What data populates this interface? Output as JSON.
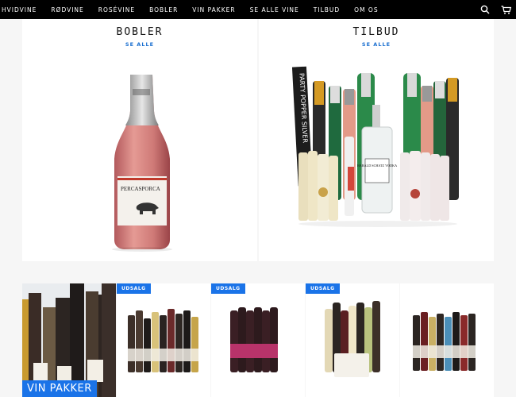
{
  "nav": {
    "items": [
      "HVIDVINE",
      "RØDVINE",
      "ROSÉVINE",
      "BOBLER",
      "VIN PAKKER",
      "SE ALLE VINE",
      "TILBUD",
      "OM OS"
    ]
  },
  "sections": [
    {
      "title": "BOBLER",
      "link": "SE ALLE"
    },
    {
      "title": "TILBUD",
      "link": "SE ALLE"
    }
  ],
  "products": {
    "bobler_bottle_label": "PERCASPORCA",
    "tilbud_banner": "PARTY POPPER SILVER",
    "tilbud_vodka": "HARALD SCHATZ VODKA"
  },
  "bottom_tiles": [
    {
      "label": "VIN PAKKER",
      "badge": ""
    },
    {
      "label": "",
      "badge": "UDSALG"
    },
    {
      "label": "",
      "badge": "UDSALG"
    },
    {
      "label": "",
      "badge": "UDSALG"
    },
    {
      "label": "",
      "badge": ""
    }
  ],
  "colors": {
    "nav_bg": "#000000",
    "accent": "#1a73e8",
    "link": "#1a6fd0"
  }
}
